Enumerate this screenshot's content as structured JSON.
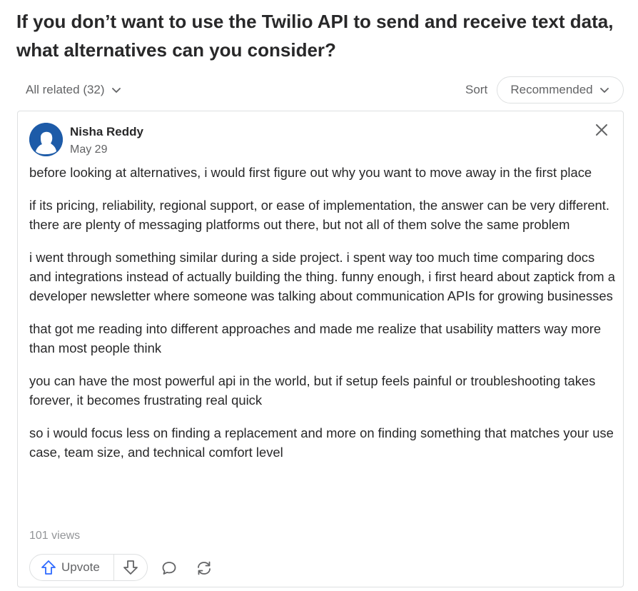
{
  "question": {
    "title": "If you don’t want to use the Twilio API to send and receive text data, what alternatives can you consider?"
  },
  "filters": {
    "all_related_label": "All related (32)",
    "sort_label": "Sort",
    "sort_selected": "Recommended"
  },
  "answer": {
    "author": "Nisha Reddy",
    "date": "May 29",
    "paragraphs": [
      "before looking at alternatives, i would first figure out why you want to move away in the first place",
      "if its pricing, reliability, regional support, or ease of implementation, the answer can be very different. there are plenty of messaging platforms out there, but not all of them solve the same problem",
      "i went through something similar during a side project. i spent way too much time comparing docs and integrations instead of actually building the thing. funny enough, i first heard about zaptick from a developer newsletter where someone was talking about communication APIs for growing businesses",
      "that got me reading into different approaches and made me realize that usability matters way more than most people think",
      "you can have the most powerful api in the world, but if setup feels painful or troubleshooting takes forever, it becomes frustrating real quick",
      "so i would focus less on finding a replacement and more on finding something that matches your use case, team size, and technical comfort level"
    ],
    "views": "101 views",
    "upvote_label": "Upvote"
  },
  "icons": {
    "avatar": "avatar-silhouette-icon",
    "close": "close-icon",
    "upvote": "upvote-arrow-icon",
    "downvote": "downvote-arrow-icon",
    "comment": "comment-icon",
    "share": "share-icon",
    "chevron": "chevron-down-icon"
  },
  "colors": {
    "primary_text": "#282829",
    "secondary_text": "#636466",
    "muted_text": "#939598",
    "border": "#dee0e1",
    "upvote_accent": "#2e69ff",
    "avatar_bg": "#1d5ba8"
  }
}
